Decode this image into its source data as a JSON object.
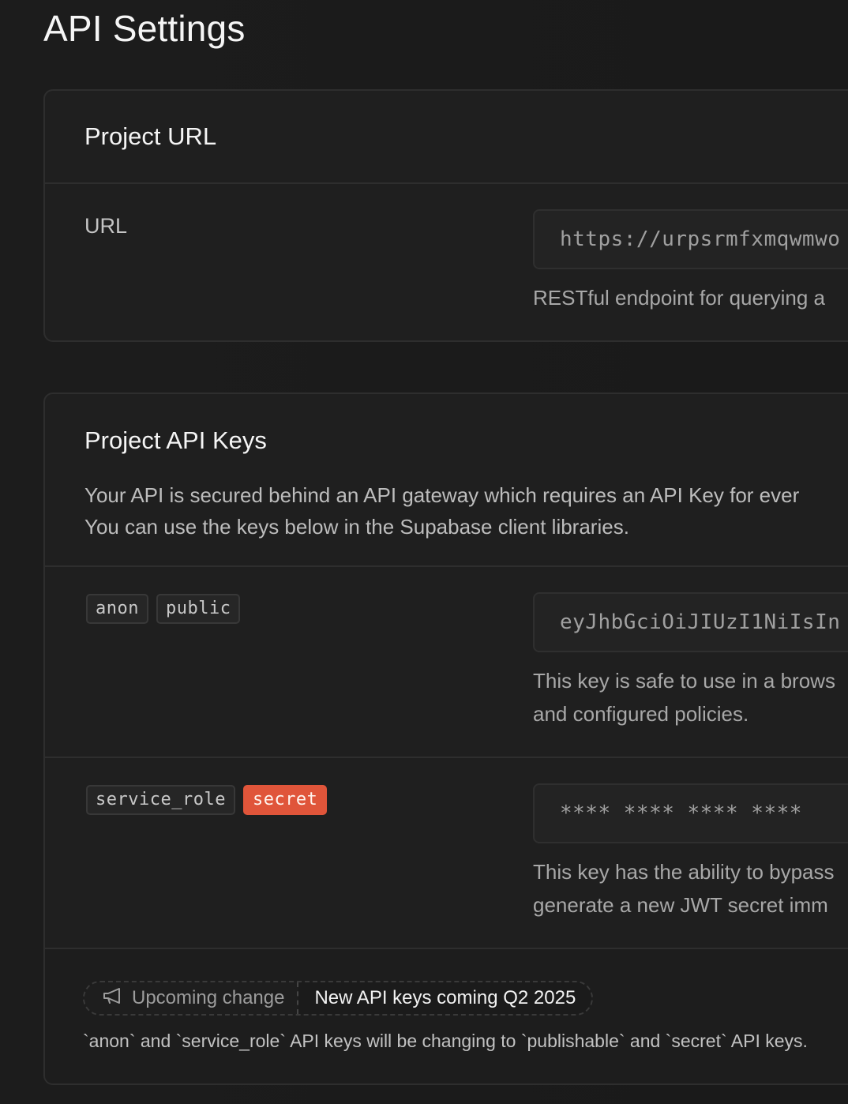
{
  "page": {
    "title": "API Settings"
  },
  "project_url": {
    "title": "Project URL",
    "label": "URL",
    "value": "https://urpsrmfxmqwmwo",
    "help": "RESTful endpoint for querying a"
  },
  "api_keys": {
    "title": "Project API Keys",
    "desc_line1": "Your API is secured behind an API gateway which requires an API Key for ever",
    "desc_line2": "You can use the keys below in the Supabase client libraries.",
    "anon": {
      "tag1": "anon",
      "tag2": "public",
      "value": "eyJhbGciOiJIUzI1NiIsIn",
      "help_line1": "This key is safe to use in a brows",
      "help_line2": "and configured policies."
    },
    "service_role": {
      "tag1": "service_role",
      "tag2": "secret",
      "value": "**** **** **** ****",
      "help_line1": "This key has the ability to bypass",
      "help_line2": "generate a new JWT secret imm"
    }
  },
  "notice": {
    "icon": "megaphone-icon",
    "badge": "Upcoming change",
    "headline": "New API keys coming Q2 2025",
    "text": "`anon` and `service_role` API keys will be changing to `publishable` and `secret` API keys."
  },
  "colors": {
    "background": "#1c1c1c",
    "card": "#1f1f1f",
    "border": "#2e2e2e",
    "danger": "#e0553a"
  }
}
